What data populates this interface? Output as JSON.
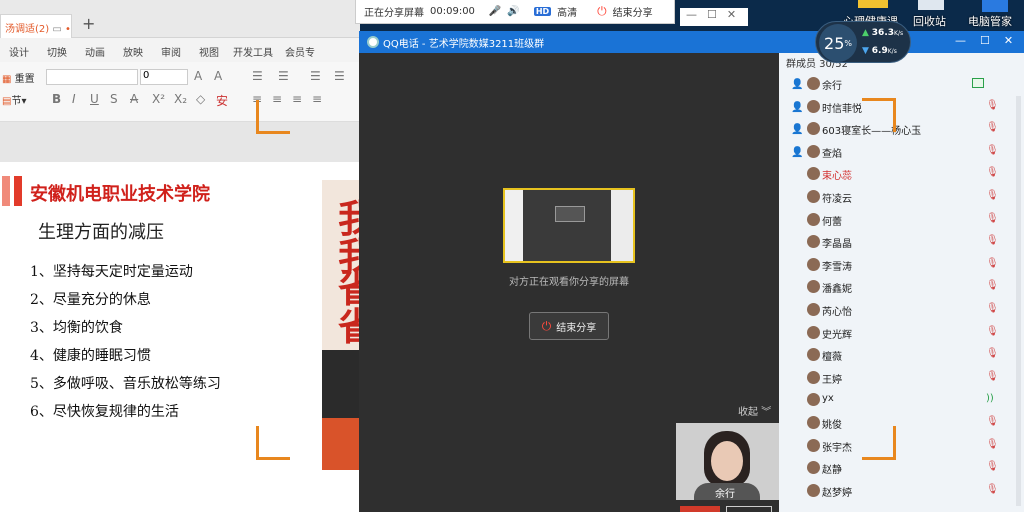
{
  "wps": {
    "doc_tab": "汤调适(2)",
    "tab_close": "•",
    "new_tab": "+",
    "menu": [
      "设计",
      "切换",
      "动画",
      "放映",
      "审阅",
      "视图",
      "开发工具",
      "会员专"
    ],
    "reset_label": "重置",
    "section_label": "节",
    "font_size": "0"
  },
  "slide": {
    "school": "安徽机电职业技术学院",
    "subtitle": "生理方面的减压",
    "items": [
      "1、坚持每天定时定量运动",
      "2、尽量充分的休息",
      "3、均衡的饮食",
      "4、健康的睡眠习惯",
      "5、多做呼吸、音乐放松等练习",
      "6、尽快恢复规律的生活"
    ],
    "poster_chars": [
      "我",
      "我",
      "省",
      "省"
    ]
  },
  "sharebar": {
    "status": "正在分享屏幕",
    "timer": "00:09:00",
    "hd": "HD",
    "quality": "高清",
    "end": "结束分享"
  },
  "desktop": {
    "icons": [
      "心理健康课",
      "回收站",
      "电脑管家"
    ]
  },
  "speed": {
    "percent": "25",
    "pct_sign": "%",
    "up": "36.3",
    "up_unit": "K/s",
    "down": "6.9",
    "down_unit": "K/s"
  },
  "qq": {
    "title": "QQ电话 - 艺术学院数媒3211班级群",
    "watching": "对方正在观看你分享的屏幕",
    "end_share": "结束分享",
    "collapse": "收起",
    "cam_name": "余行",
    "members_header": "群成员 30/52",
    "members": [
      {
        "name": "余行",
        "mic": "on",
        "host": true
      },
      {
        "name": "时信菲悦",
        "mic": "off",
        "host": true
      },
      {
        "name": "603寝室长——杨心玉",
        "mic": "off",
        "host": true
      },
      {
        "name": "查焰",
        "mic": "off",
        "host": true
      },
      {
        "name": "束心蕊",
        "mic": "off",
        "host": false,
        "red": true
      },
      {
        "name": "符凌云",
        "mic": "off",
        "host": false
      },
      {
        "name": "何蕾",
        "mic": "off",
        "host": false
      },
      {
        "name": "李晶晶",
        "mic": "off",
        "host": false
      },
      {
        "name": "李雪涛",
        "mic": "off",
        "host": false
      },
      {
        "name": "潘鑫妮",
        "mic": "off",
        "host": false
      },
      {
        "name": "芮心怡",
        "mic": "off",
        "host": false
      },
      {
        "name": "史光辉",
        "mic": "off",
        "host": false
      },
      {
        "name": "檀薇",
        "mic": "off",
        "host": false
      },
      {
        "name": "王婷",
        "mic": "off",
        "host": false
      },
      {
        "name": "yx",
        "mic": "speaking",
        "host": false
      },
      {
        "name": "姚俊",
        "mic": "off",
        "host": false
      },
      {
        "name": "张宇杰",
        "mic": "off",
        "host": false
      },
      {
        "name": "赵静",
        "mic": "off",
        "host": false
      },
      {
        "name": "赵梦婷",
        "mic": "off",
        "host": false
      }
    ]
  },
  "colors": {
    "accent": "#1a73d6",
    "slide_red": "#d0211b",
    "frame_orange": "#e8871e"
  }
}
